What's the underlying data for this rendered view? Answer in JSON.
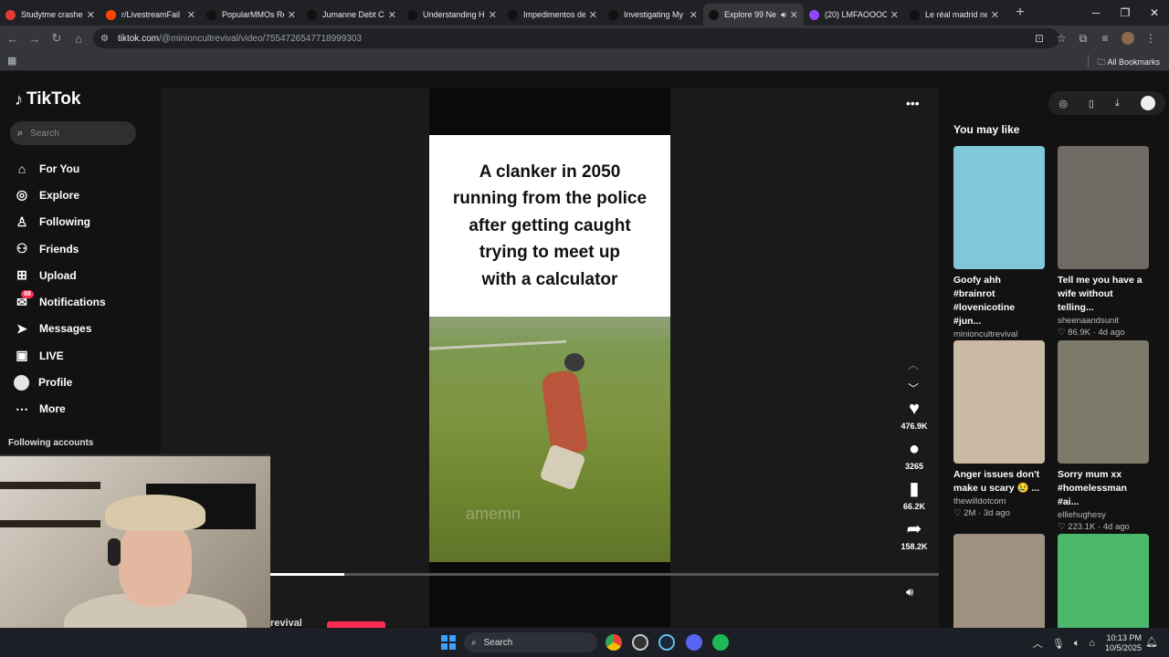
{
  "browser": {
    "tabs": [
      {
        "title": "Studytme crashes",
        "color": "#e53935"
      },
      {
        "title": "r/LivestreamFail",
        "color": "#ff4500"
      },
      {
        "title": "PopularMMOs Re",
        "color": "#111111"
      },
      {
        "title": "Jumanne Debt Co",
        "color": "#111111"
      },
      {
        "title": "Understanding H",
        "color": "#111111"
      },
      {
        "title": "Impedimentos de",
        "color": "#111111"
      },
      {
        "title": "Investigating My",
        "color": "#111111"
      },
      {
        "title": "Explore 99 Ne",
        "color": "#111111",
        "active": true
      },
      {
        "title": "(20) LMFAOOOO",
        "color": "#9146ff"
      },
      {
        "title": "Le réal madrid ne",
        "color": "#111111"
      }
    ],
    "url_host": "tiktok.com",
    "url_path": "/@minioncultrevival/video/7554726547718999303",
    "all_bookmarks": "All Bookmarks"
  },
  "sidebar": {
    "logo": "TikTok",
    "search_placeholder": "Search",
    "items": [
      {
        "label": "For You",
        "icon": "home-icon"
      },
      {
        "label": "Explore",
        "icon": "compass-icon"
      },
      {
        "label": "Following",
        "icon": "following-icon"
      },
      {
        "label": "Friends",
        "icon": "friends-icon"
      },
      {
        "label": "Upload",
        "icon": "upload-icon"
      },
      {
        "label": "Notifications",
        "icon": "inbox-icon",
        "badge": "88"
      },
      {
        "label": "Messages",
        "icon": "messages-icon"
      },
      {
        "label": "LIVE",
        "icon": "live-icon"
      },
      {
        "label": "Profile",
        "icon": "profile-icon"
      },
      {
        "label": "More",
        "icon": "more-icon"
      }
    ],
    "following_accounts": "Following accounts"
  },
  "video": {
    "caption": "A clanker in 2050\nrunning from the police\nafter getting caught\ntrying to meet up\nwith a calculator",
    "watermark": "amemn",
    "likes": "476.9K",
    "comments": "3265",
    "saves": "66.2K",
    "shares": "158.2K",
    "progress_fraction": 0.11,
    "bottom_user": "revival"
  },
  "recommendations": {
    "title": "You may like",
    "items": [
      {
        "title": "Goofy ahh #brainrot #lovenicotine #jun...",
        "user": "minioncultrevival",
        "likes": "5",
        "age": "4d ago",
        "thumb_bg": "#7fc7d9"
      },
      {
        "title": "Tell me you have a wife without telling...",
        "user": "sheenaandsunit",
        "likes": "86.9K",
        "age": "4d ago",
        "thumb_bg": "#6f6a63"
      },
      {
        "title": "Anger issues don't make u scary 😢 ...",
        "user": "thewilldotcom",
        "likes": "2M",
        "age": "3d ago",
        "thumb_bg": "#c9b9a5"
      },
      {
        "title": "Sorry mum xx #homelessman #ai...",
        "user": "elliehughesy",
        "likes": "223.1K",
        "age": "4d ago",
        "thumb_bg": "#7d7a6a"
      },
      {
        "title": "",
        "user": "",
        "likes": "",
        "age": "",
        "thumb_bg": "#a09080"
      },
      {
        "title": "",
        "user": "",
        "likes": "",
        "age": "",
        "thumb_bg": "#4bb86a"
      }
    ]
  },
  "taskbar": {
    "search": "Search",
    "time": "10:13 PM",
    "date": "10/5/2025"
  }
}
